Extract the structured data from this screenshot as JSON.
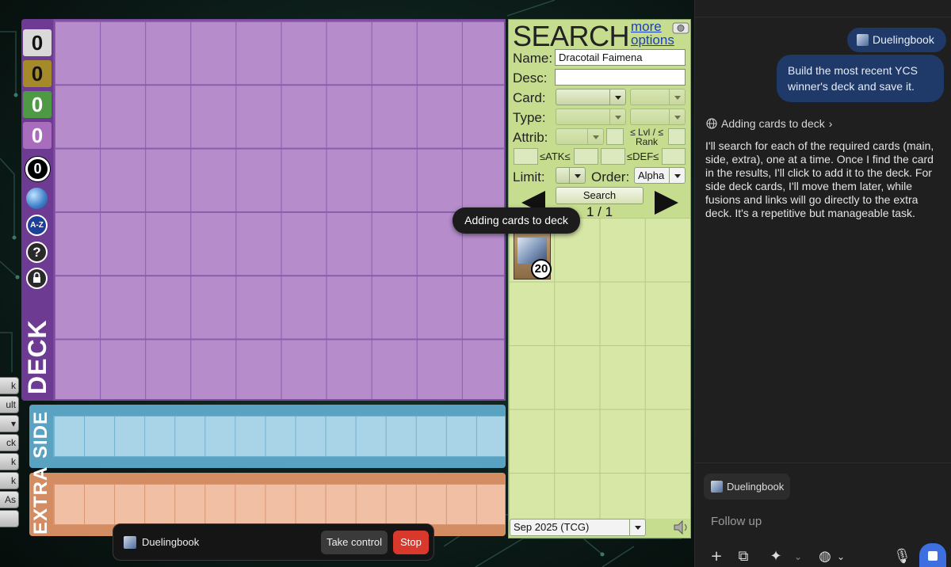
{
  "deck": {
    "counters": [
      "0",
      "0",
      "0",
      "0"
    ],
    "counter_colors": [
      "#d9d9d9",
      "#a58a2a",
      "#4e9a44",
      "#a86dbd"
    ],
    "total": "0",
    "label": "DECK",
    "side_label": "SIDE",
    "extra_label": "EXTRA",
    "icons": [
      "globe-icon",
      "sort-az-icon",
      "help-icon",
      "lock-icon"
    ],
    "az_text": "A-Z",
    "help_text": "?"
  },
  "left_stubs": [
    "k",
    "ult",
    "▾",
    "ck",
    "k",
    "k",
    "As",
    ""
  ],
  "search": {
    "title": "SEARCH",
    "more_options": "more options",
    "name_label": "Name:",
    "name_value": "Dracotail Faimena",
    "desc_label": "Desc:",
    "desc_value": "",
    "card_label": "Card:",
    "type_label": "Type:",
    "attrib_label": "Attrib:",
    "lvl_rank_label": "≤ Lvl / ≤ Rank",
    "atk_label": "≤ATK≤",
    "def_label": "≤DEF≤",
    "limit_label": "Limit:",
    "order_label": "Order:",
    "order_value": "Alpha",
    "search_button": "Search",
    "page_indicator": "1 / 1",
    "result_count": "20",
    "format_value": "Sep 2025 (TCG)"
  },
  "tooltip": "Adding cards to deck",
  "control_bar": {
    "site": "Duelingbook",
    "take_control": "Take control",
    "stop": "Stop"
  },
  "chat": {
    "site_pill": "Duelingbook",
    "user_message": "Build the most recent YCS winner's deck and save it.",
    "status": "Adding cards to deck",
    "assistant_message": "I'll search for each of the required cards (main, side, extra), one at a time. Once I find the card in the results, I'll click to add it to the deck. For side deck cards, I'll move them later, while fusions and links will go directly to the extra deck. It's a repetitive but manageable task.",
    "tab_chip": "Duelingbook",
    "input_placeholder": "Follow up"
  }
}
